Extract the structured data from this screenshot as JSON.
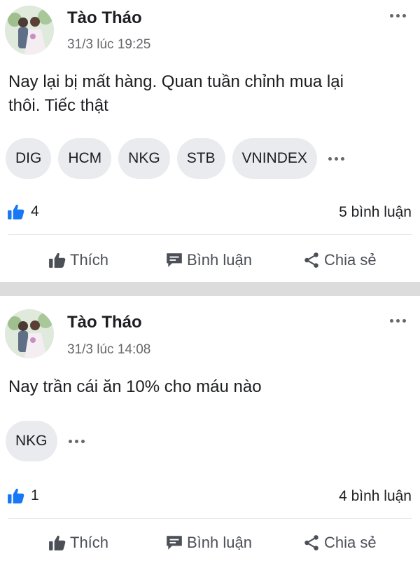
{
  "posts": [
    {
      "author": "Tào Tháo",
      "time": "31/3 lúc 19:25",
      "lines": [
        "Nay lại bị mất hàng. Quan tuần chỉnh mua lại",
        "thôi. Tiếc thật"
      ],
      "tags": [
        "DIG",
        "HCM",
        "NKG",
        "STB",
        "VNINDEX"
      ],
      "likes": "4",
      "comments": "5 bình luận"
    },
    {
      "author": "Tào Tháo",
      "time": "31/3 lúc 14:08",
      "lines": [
        "Nay trần cái ăn 10% cho máu nào"
      ],
      "tags": [
        "NKG"
      ],
      "likes": "1",
      "comments": "4 bình luận"
    }
  ],
  "actions": {
    "like": "Thích",
    "comment": "Bình luận",
    "share": "Chia sẻ"
  },
  "colors": {
    "like_blue": "#1877f2",
    "tag_bg": "#e9ebee",
    "divider": "#dcdcdc",
    "secondary_text": "#65676b"
  },
  "icons": [
    "more-dots-icon",
    "thumbs-up-icon",
    "comment-icon",
    "share-icon"
  ]
}
